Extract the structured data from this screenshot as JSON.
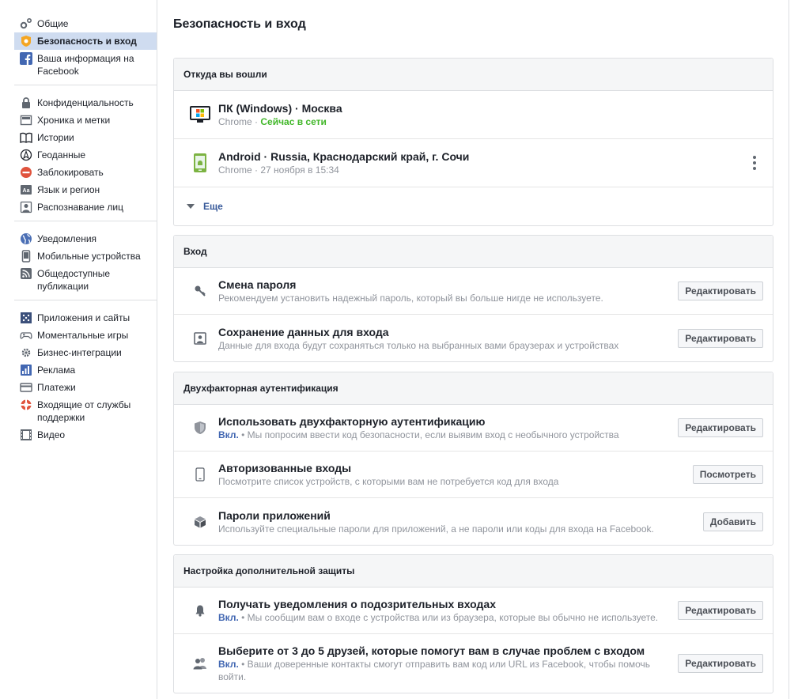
{
  "sidebar": {
    "groups": [
      [
        {
          "label": "Общие",
          "icon": "gear-icon"
        },
        {
          "label": "Безопасность и вход",
          "icon": "shield-badge-icon",
          "active": true
        },
        {
          "label": "Ваша информация на Facebook",
          "icon": "facebook-icon"
        }
      ],
      [
        {
          "label": "Конфиденциальность",
          "icon": "lock-icon"
        },
        {
          "label": "Хроника и метки",
          "icon": "timeline-icon"
        },
        {
          "label": "Истории",
          "icon": "book-icon"
        },
        {
          "label": "Геоданные",
          "icon": "location-icon"
        },
        {
          "label": "Заблокировать",
          "icon": "block-icon"
        },
        {
          "label": "Язык и регион",
          "icon": "language-icon"
        },
        {
          "label": "Распознавание лиц",
          "icon": "face-recognition-icon"
        }
      ],
      [
        {
          "label": "Уведомления",
          "icon": "globe-icon"
        },
        {
          "label": "Мобильные устройства",
          "icon": "mobile-icon"
        },
        {
          "label": "Общедоступные публикации",
          "icon": "rss-icon"
        }
      ],
      [
        {
          "label": "Приложения и сайты",
          "icon": "apps-icon"
        },
        {
          "label": "Моментальные игры",
          "icon": "gamepad-icon"
        },
        {
          "label": "Бизнес-интеграции",
          "icon": "business-gear-icon"
        },
        {
          "label": "Реклама",
          "icon": "ads-icon"
        },
        {
          "label": "Платежи",
          "icon": "payment-card-icon"
        },
        {
          "label": "Входящие от службы поддержки",
          "icon": "lifebuoy-icon"
        },
        {
          "label": "Видео",
          "icon": "film-icon"
        }
      ]
    ]
  },
  "page": {
    "title": "Безопасность и вход"
  },
  "where": {
    "header": "Откуда вы вошли",
    "sessions": [
      {
        "device": "ПК (Windows) · Москва",
        "browser": "Chrome",
        "sep": " · ",
        "status": "Сейчас в сети"
      },
      {
        "device": "Android · Russia, Краснодарский край, г. Сочи",
        "browser": "Chrome",
        "sep": " · ",
        "status": "27 ноября в 15:34"
      }
    ],
    "more": "Еще"
  },
  "login": {
    "header": "Вход",
    "rows": [
      {
        "title": "Смена пароля",
        "sub": "Рекомендуем установить надежный пароль, который вы больше нигде не используете.",
        "button": "Редактировать"
      },
      {
        "title": "Сохранение данных для входа",
        "sub": "Данные для входа будут сохраняться только на выбранных вами браузерах и устройствах",
        "button": "Редактировать"
      }
    ]
  },
  "twofa": {
    "header": "Двухфакторная аутентификация",
    "rows": [
      {
        "title": "Использовать двухфакторную аутентификацию",
        "on": "Вкл.",
        "sub": " • Мы попросим ввести код безопасности, если выявим вход с необычного устройства",
        "button": "Редактировать"
      },
      {
        "title": "Авторизованные входы",
        "sub": "Посмотрите список устройств, с которыми вам не потребуется код для входа",
        "button": "Посмотреть"
      },
      {
        "title": "Пароли приложений",
        "sub": "Используйте специальные пароли для приложений, а не пароли или коды для входа на Facebook.",
        "button": "Добавить"
      }
    ]
  },
  "extra": {
    "header": "Настройка дополнительной защиты",
    "rows": [
      {
        "title": "Получать уведомления о подозрительных входах",
        "on": "Вкл.",
        "sub": " • Мы сообщим вам о входе с устройства или из браузера, которые вы обычно не используете.",
        "button": "Редактировать"
      },
      {
        "title": "Выберите от 3 до 5 друзей, которые помогут вам в случае проблем с входом",
        "on": "Вкл.",
        "sub": " • Ваши доверенные контакты смогут отправить вам код или URL из Facebook, чтобы помочь войти.",
        "button": "Редактировать"
      }
    ]
  },
  "colors": {
    "accent": "#4267b2",
    "online": "#42b72a",
    "active_bg": "#cfdcf0"
  }
}
